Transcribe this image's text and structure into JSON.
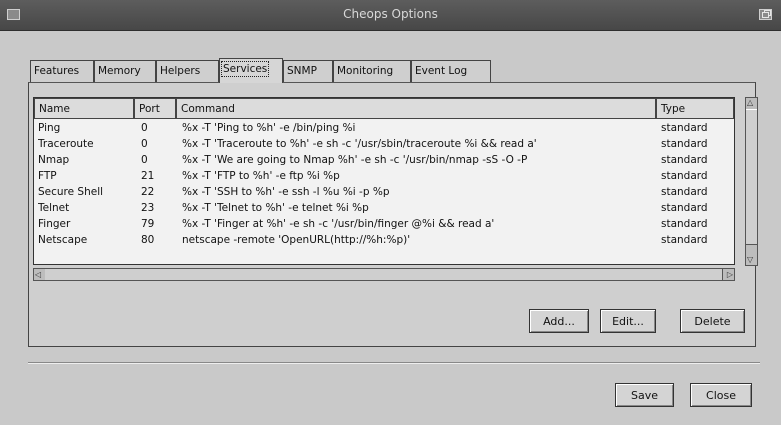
{
  "window": {
    "title": "Cheops Options"
  },
  "tabs": [
    {
      "label": "Features"
    },
    {
      "label": "Memory"
    },
    {
      "label": "Helpers"
    },
    {
      "label": "Services"
    },
    {
      "label": "SNMP"
    },
    {
      "label": "Monitoring"
    },
    {
      "label": "Event Log"
    }
  ],
  "active_tab": "Services",
  "table": {
    "columns": [
      "Name",
      "Port",
      "Command",
      "Type"
    ],
    "rows": [
      {
        "name": "Ping",
        "port": "0",
        "command": "%x -T 'Ping to %h' -e /bin/ping %i",
        "type": "standard"
      },
      {
        "name": "Traceroute",
        "port": "0",
        "command": "%x -T 'Traceroute to %h' -e sh -c '/usr/sbin/traceroute %i  && read a'",
        "type": "standard"
      },
      {
        "name": "Nmap",
        "port": "0",
        "command": "%x -T 'We are going to Nmap %h' -e sh -c '/usr/bin/nmap -sS -O -P",
        "type": "standard"
      },
      {
        "name": "FTP",
        "port": "21",
        "command": "%x -T 'FTP to %h' -e ftp %i %p",
        "type": "standard"
      },
      {
        "name": "Secure Shell",
        "port": "22",
        "command": "%x -T 'SSH to %h' -e ssh -l %u %i -p %p",
        "type": "standard"
      },
      {
        "name": "Telnet",
        "port": "23",
        "command": "%x -T 'Telnet to %h' -e telnet %i %p",
        "type": "standard"
      },
      {
        "name": "Finger",
        "port": "79",
        "command": "%x -T 'Finger at %h' -e sh -c '/usr/bin/finger @%i  && read a'",
        "type": "standard"
      },
      {
        "name": "Netscape",
        "port": "80",
        "command": "netscape -remote 'OpenURL(http://%h:%p)'",
        "type": "standard"
      }
    ]
  },
  "buttons": {
    "add": "Add...",
    "edit": "Edit...",
    "delete": "Delete",
    "save": "Save",
    "close": "Close"
  },
  "icons": {
    "window_menu": "window-menu-icon",
    "maximize": "maximize-icon",
    "scroll_up": "scroll-up-arrow-icon",
    "scroll_down": "scroll-down-arrow-icon",
    "scroll_left": "scroll-left-arrow-icon",
    "scroll_right": "scroll-right-arrow-icon"
  },
  "colors": {
    "titlebar": "#4f4f4f",
    "dialog_bg": "#c9c9c9",
    "list_bg": "#f2f2f2"
  }
}
